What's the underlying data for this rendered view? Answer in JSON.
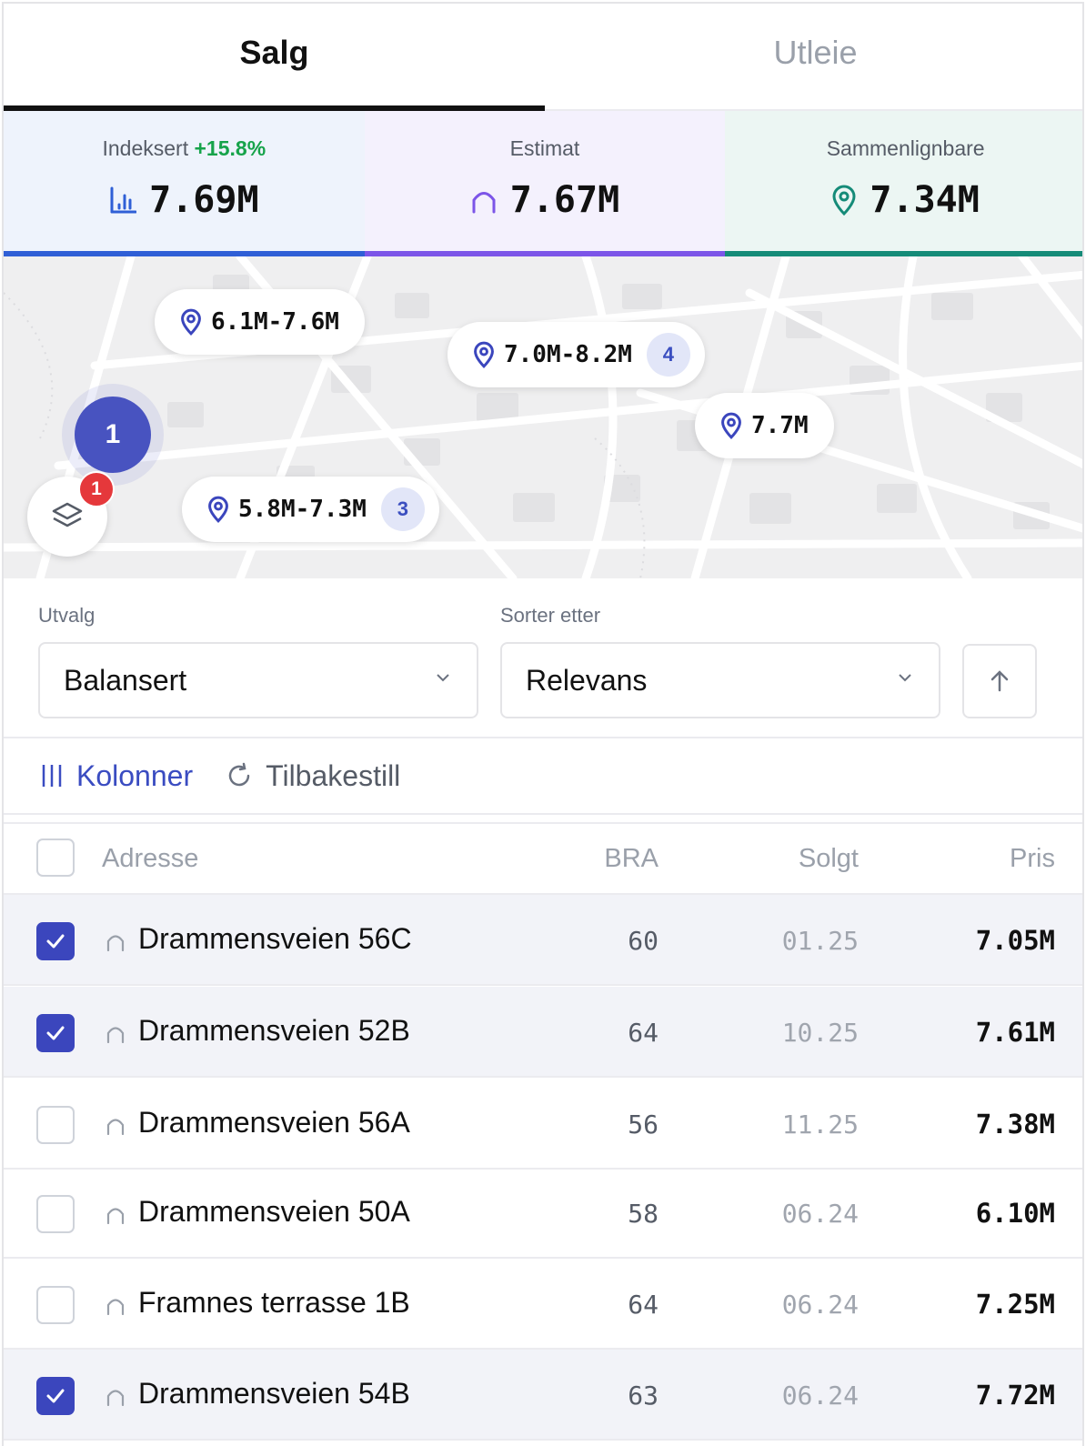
{
  "tabs": [
    {
      "label": "Salg",
      "active": true
    },
    {
      "label": "Utleie",
      "active": false
    }
  ],
  "stats": {
    "indexed": {
      "label": "Indeksert",
      "delta": "+15.8%",
      "value": "7.69M",
      "icon": "bar-chart-icon",
      "color": "#2f5fd6"
    },
    "estimate": {
      "label": "Estimat",
      "value": "7.67M",
      "icon": "house-icon",
      "color": "#7c55e8"
    },
    "comparables": {
      "label": "Sammenlignbare",
      "value": "7.34M",
      "icon": "map-pin-icon",
      "color": "#158b78"
    }
  },
  "map": {
    "markers": [
      {
        "label": "6.1M-7.6M",
        "count": ""
      },
      {
        "label": "7.0M-8.2M",
        "count": "4"
      },
      {
        "label": "7.7M",
        "count": ""
      },
      {
        "label": "5.8M-7.3M",
        "count": "3"
      }
    ],
    "cluster_count": "1",
    "layers_badge": "1"
  },
  "filters": {
    "selection": {
      "label": "Utvalg",
      "value": "Balansert"
    },
    "sort": {
      "label": "Sorter etter",
      "value": "Relevans",
      "direction_icon": "arrow-up-icon"
    }
  },
  "toolbar": {
    "columns_label": "Kolonner",
    "reset_label": "Tilbakestill"
  },
  "table": {
    "headers": {
      "address": "Adresse",
      "bra": "BRA",
      "sold": "Solgt",
      "price": "Pris"
    },
    "rows": [
      {
        "address": "Drammensveien 56C",
        "bra": "60",
        "sold": "01.25",
        "price": "7.05M",
        "checked": true
      },
      {
        "address": "Drammensveien 52B",
        "bra": "64",
        "sold": "10.25",
        "price": "7.61M",
        "checked": true
      },
      {
        "address": "Drammensveien 56A",
        "bra": "56",
        "sold": "11.25",
        "price": "7.38M",
        "checked": false
      },
      {
        "address": "Drammensveien 50A",
        "bra": "58",
        "sold": "06.24",
        "price": "6.10M",
        "checked": false
      },
      {
        "address": "Framnes terrasse 1B",
        "bra": "64",
        "sold": "06.24",
        "price": "7.25M",
        "checked": false
      },
      {
        "address": "Drammensveien 54B",
        "bra": "63",
        "sold": "06.24",
        "price": "7.72M",
        "checked": true
      }
    ]
  },
  "colors": {
    "accent": "#3b46bd",
    "positive": "#16a34a",
    "badge": "#e5383b"
  }
}
